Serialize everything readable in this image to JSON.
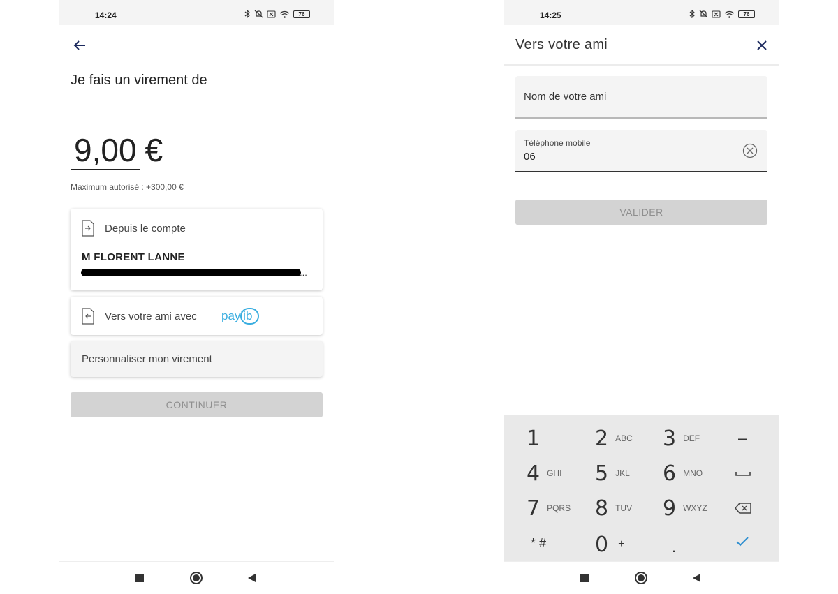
{
  "left_screen": {
    "status": {
      "time": "14:24",
      "battery": "76"
    },
    "heading": "Je fais un virement de",
    "amount": {
      "value": "9,00",
      "currency": "€"
    },
    "max_note": "Maximum autorisé : +300,00 €",
    "from_card": {
      "label": "Depuis le compte",
      "account_name": "M FLORENT LANNE",
      "ellipsis": "..."
    },
    "to_card": {
      "label": "Vers votre ami avec",
      "logo_text": "paylib"
    },
    "custom_card": {
      "label": "Personnaliser mon virement"
    },
    "continue_label": "CONTINUER"
  },
  "right_screen": {
    "status": {
      "time": "14:25",
      "battery": "76"
    },
    "title": "Vers votre ami",
    "name_field": {
      "label": "Nom de votre ami"
    },
    "phone_field": {
      "label": "Téléphone mobile",
      "value": "06"
    },
    "validate_label": "VALIDER",
    "keypad": {
      "keys": [
        {
          "num": "1",
          "letters": ""
        },
        {
          "num": "2",
          "letters": "ABC"
        },
        {
          "num": "3",
          "letters": "DEF"
        },
        {
          "num": "4",
          "letters": "GHI"
        },
        {
          "num": "5",
          "letters": "JKL"
        },
        {
          "num": "6",
          "letters": "MNO"
        },
        {
          "num": "7",
          "letters": "PQRS"
        },
        {
          "num": "8",
          "letters": "TUV"
        },
        {
          "num": "9",
          "letters": "WXYZ"
        },
        {
          "num": "0",
          "letters": "+"
        }
      ],
      "star_hash": "* #",
      "dot": ".",
      "minus": "–"
    }
  },
  "colors": {
    "accent_navy": "#1c2a5e",
    "paylib_blue": "#3aaee0",
    "keypad_check": "#2f8fd0",
    "disabled_button": "#d3d3d3"
  }
}
